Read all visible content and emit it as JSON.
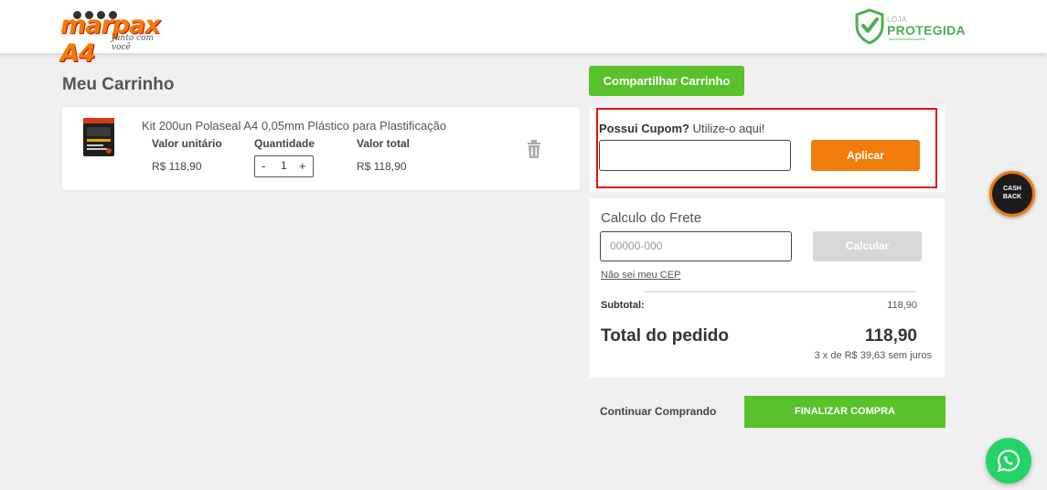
{
  "header": {
    "logo_text": "marpax A4",
    "logo_tagline": "Junto com você",
    "secure_badge_small": "LOJA",
    "secure_badge_text": "PROTEGIDA"
  },
  "cart": {
    "title": "Meu Carrinho",
    "share_label": "Compartilhar Carrinho",
    "item": {
      "name": "Kit 200un Polaseal A4 0,05mm Plástico para Plastificação",
      "unit_price_label": "Valor unitário",
      "quantity_label": "Quantidade",
      "total_label": "Valor total",
      "unit_price": "R$ 118,90",
      "quantity": "1",
      "total": "R$ 118,90",
      "decrement": "-",
      "increment": "+"
    }
  },
  "coupon": {
    "title_bold": "Possui Cupom?",
    "title_rest": " Utilize-o aqui!",
    "input_value": "",
    "apply_label": "Aplicar"
  },
  "shipping": {
    "title": "Calculo do Frete",
    "cep_placeholder": "00000-000",
    "calc_label": "Calcular",
    "dont_know_cep": "Não sei meu CEP"
  },
  "summary": {
    "subtotal_label": "Subtotal:",
    "subtotal_value": "118,90",
    "total_label": "Total do pedido",
    "total_value": "118,90",
    "installments": "3 x de R$ 39,63 sem juros"
  },
  "actions": {
    "continue_label": "Continuar Comprando",
    "finalize_label": "FINALIZAR COMPRA"
  },
  "widgets": {
    "cashback_line1": "CASH",
    "cashback_line2": "BACK"
  },
  "colors": {
    "brand_green": "#59c12b",
    "brand_orange": "#ef7c0b",
    "highlight_red": "#e01010"
  }
}
